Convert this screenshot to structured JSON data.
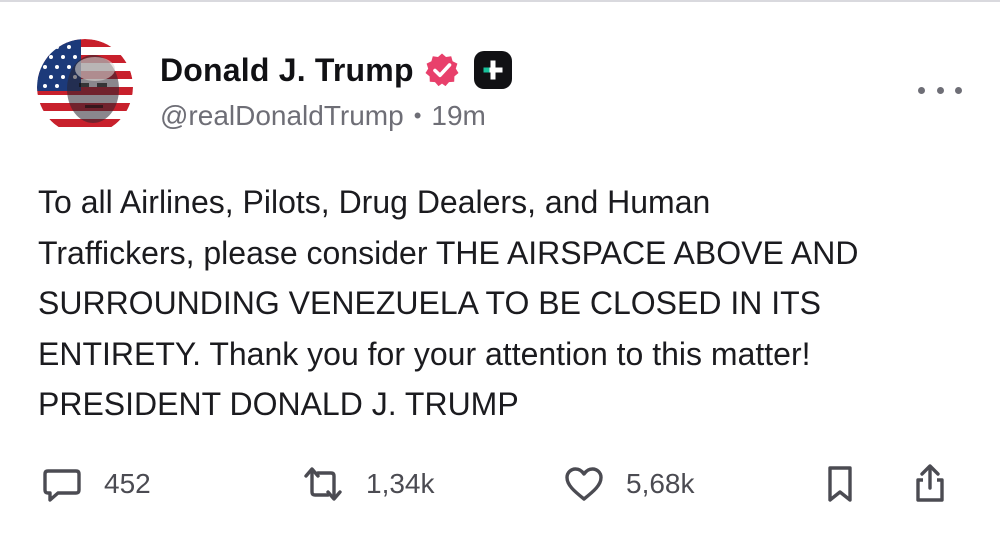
{
  "author": {
    "display_name": "Donald J. Trump",
    "handle": "@realDonaldTrump",
    "separator": "•",
    "time_ago": "19m",
    "verified_color": "#e8406b",
    "avatar_icon": "flag-portrait-avatar",
    "plus_badge_icon": "plus-badge-icon"
  },
  "post": {
    "lines": [
      "To all Airlines, Pilots, Drug Dealers, and Human",
      "Traffickers, please consider THE AIRSPACE ABOVE AND",
      "SURROUNDING VENEZUELA TO BE CLOSED IN ITS",
      "ENTIRETY. Thank you for your attention to this matter!",
      "PRESIDENT DONALD J. TRUMP"
    ]
  },
  "actions": {
    "reply": {
      "icon": "comment-icon",
      "count": "452"
    },
    "repost": {
      "icon": "repost-icon",
      "count": "1,34k"
    },
    "like": {
      "icon": "heart-icon",
      "count": "5,68k"
    },
    "bookmark": {
      "icon": "bookmark-icon"
    },
    "share": {
      "icon": "share-icon"
    }
  },
  "colors": {
    "text": "#1b1b1f",
    "muted": "#6e6e76",
    "icon": "#4b4b52"
  }
}
